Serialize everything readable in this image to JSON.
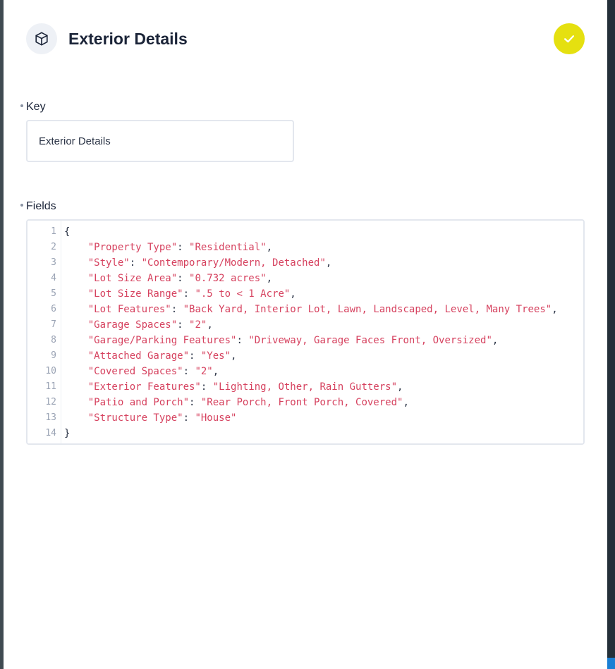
{
  "header": {
    "title": "Exterior Details",
    "icon": "cube-icon",
    "confirm_icon": "check-icon"
  },
  "key_field": {
    "label": "Key",
    "value": "Exterior Details"
  },
  "fields_field": {
    "label": "Fields",
    "line_numbers": [
      "1",
      "2",
      "3",
      "4",
      "5",
      "6",
      "7",
      "8",
      "9",
      "10",
      "11",
      "12",
      "13",
      "14"
    ],
    "open_brace": "{",
    "close_brace": "}",
    "entries": [
      {
        "key": "\"Property Type\"",
        "value": "\"Residential\""
      },
      {
        "key": "\"Style\"",
        "value": "\"Contemporary/Modern, Detached\""
      },
      {
        "key": "\"Lot Size Area\"",
        "value": "\"0.732 acres\""
      },
      {
        "key": "\"Lot Size Range\"",
        "value": "\".5 to < 1 Acre\""
      },
      {
        "key": "\"Lot Features\"",
        "value": "\"Back Yard, Interior Lot, Lawn, Landscaped, Level, Many Trees\""
      },
      {
        "key": "\"Garage Spaces\"",
        "value": "\"2\""
      },
      {
        "key": "\"Garage/Parking Features\"",
        "value": "\"Driveway, Garage Faces Front, Oversized\""
      },
      {
        "key": "\"Attached Garage\"",
        "value": "\"Yes\""
      },
      {
        "key": "\"Covered Spaces\"",
        "value": "\"2\""
      },
      {
        "key": "\"Exterior Features\"",
        "value": "\"Lighting, Other, Rain Gutters\""
      },
      {
        "key": "\"Patio and Porch\"",
        "value": "\"Rear Porch, Front Porch, Covered\""
      },
      {
        "key": "\"Structure Type\"",
        "value": "\"House\""
      }
    ]
  },
  "colors": {
    "accent_button": "#e5e010",
    "string": "#d6425f",
    "sidebar_dark": "#2d3e48",
    "scroll_accent": "#1a7fd4"
  }
}
